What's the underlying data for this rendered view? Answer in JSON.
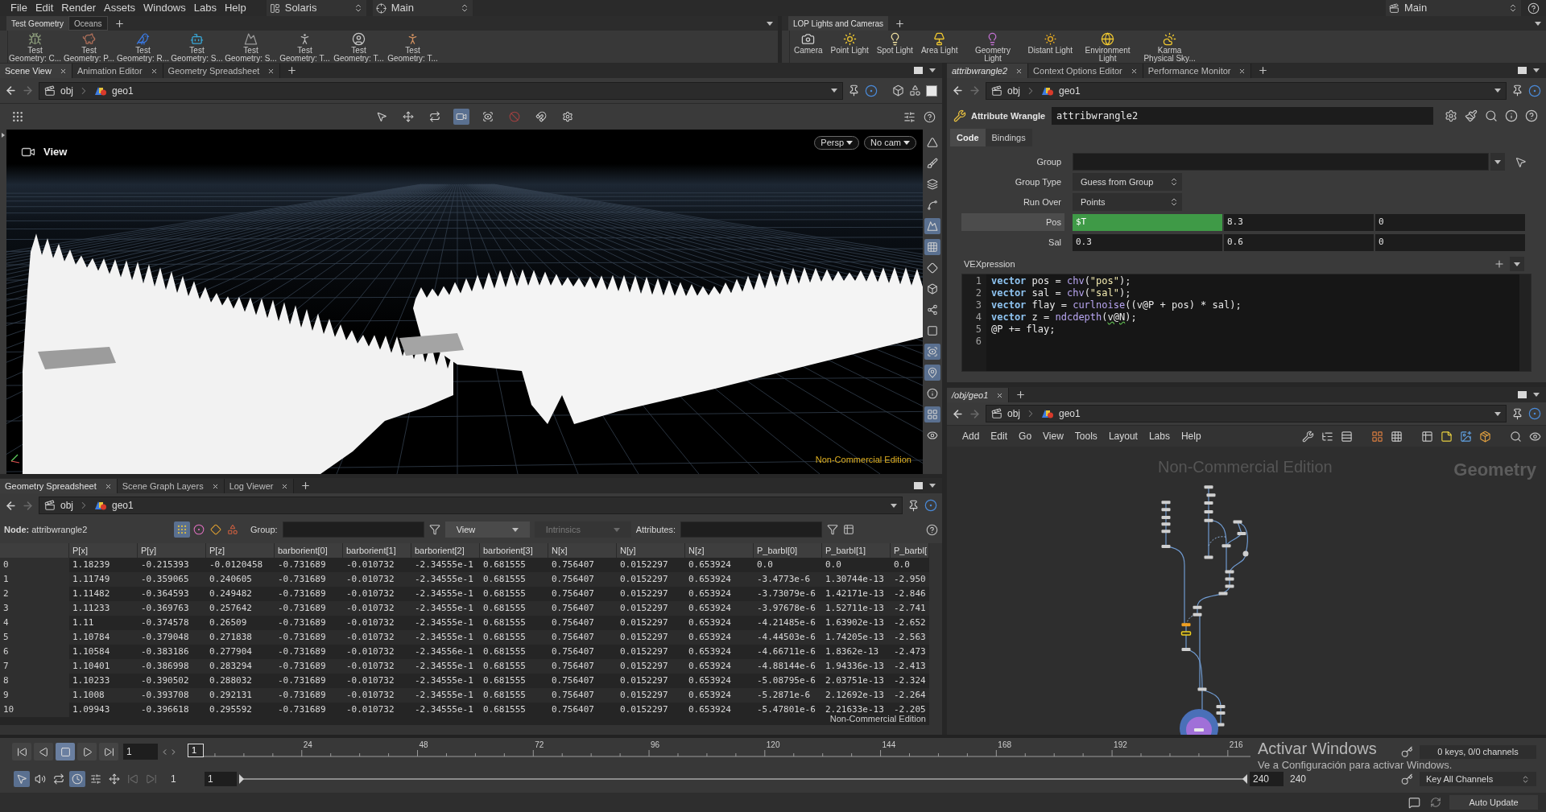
{
  "menu_bar": {
    "items": [
      "File",
      "Edit",
      "Render",
      "Assets",
      "Windows",
      "Labs",
      "Help"
    ],
    "desktop": "Solaris",
    "context": "Main",
    "right_desktop": "Main"
  },
  "shelves": [
    {
      "tabs": [
        {
          "label": "Test Geometry",
          "selected": true
        },
        {
          "label": "Oceans",
          "selected": false
        }
      ],
      "tools": [
        "Test Geometry: C...",
        "Test Geometry: P...",
        "Test Geometry: R...",
        "Test Geometry: S...",
        "Test Geometry: S...",
        "Test Geometry: T...",
        "Test Geometry: T...",
        "Test Geometry: T..."
      ]
    },
    {
      "tabs": [
        {
          "label": "LOP Lights and Cameras",
          "selected": true
        }
      ],
      "tools": [
        "Camera",
        "Point Light",
        "Spot Light",
        "Area Light",
        "Geometry Light",
        "Distant Light",
        "Environment Light",
        "Karma Physical Sky..."
      ]
    }
  ],
  "scene_view": {
    "tabs": [
      {
        "label": "Scene View",
        "selected": true
      },
      {
        "label": "Animation Editor",
        "selected": false
      },
      {
        "label": "Geometry Spreadsheet",
        "selected": false
      }
    ],
    "path": [
      "obj",
      "geo1"
    ],
    "viewport": {
      "title": "View",
      "camera_menus": [
        "Persp",
        "No cam"
      ],
      "watermark": "Non-Commercial Edition"
    }
  },
  "spreadsheet": {
    "tabs": [
      {
        "label": "Geometry Spreadsheet",
        "selected": true
      },
      {
        "label": "Scene Graph Layers",
        "selected": false
      },
      {
        "label": "Log Viewer",
        "selected": false
      }
    ],
    "path": [
      "obj",
      "geo1"
    ],
    "node_label": "**Node:** attribwrangle2",
    "element_types": [
      {
        "selected": true
      },
      {
        "selected": false
      },
      {
        "selected": false
      },
      {
        "selected": false
      }
    ],
    "group_label": "Group:",
    "view_menu": "View",
    "intrinsics_menu": {
      "label": "Intrinsics",
      "disabled": true
    },
    "attributes_label": "Attributes:",
    "columns": [
      "P[x]",
      "P[y]",
      "P[z]",
      "barborient[0]",
      "barborient[1]",
      "barborient[2]",
      "barborient[3]",
      "N[x]",
      "N[y]",
      "N[z]",
      "P_barbl[0]",
      "P_barbl[1]",
      "P_barbl["
    ],
    "rows": [
      {
        "index": "0",
        "cells": [
          "1.18239",
          "-0.215393",
          "-0.0120458",
          "-0.731689",
          "-0.010732",
          "-2.34555e-1",
          "0.681555",
          "0.756407",
          "0.0152297",
          "0.653924",
          "0.0",
          "0.0",
          "0.0"
        ]
      },
      {
        "index": "1",
        "cells": [
          "1.11749",
          "-0.359065",
          "0.240605",
          "-0.731689",
          "-0.010732",
          "-2.34555e-1",
          "0.681555",
          "0.756407",
          "0.0152297",
          "0.653924",
          "-3.4773e-6",
          "1.30744e-13",
          "-2.950"
        ]
      },
      {
        "index": "2",
        "cells": [
          "1.11482",
          "-0.364593",
          "0.249482",
          "-0.731689",
          "-0.010732",
          "-2.34555e-1",
          "0.681555",
          "0.756407",
          "0.0152297",
          "0.653924",
          "-3.73079e-6",
          "1.42171e-13",
          "-2.846"
        ]
      },
      {
        "index": "3",
        "cells": [
          "1.11233",
          "-0.369763",
          "0.257642",
          "-0.731689",
          "-0.010732",
          "-2.34555e-1",
          "0.681555",
          "0.756407",
          "0.0152297",
          "0.653924",
          "-3.97678e-6",
          "1.52711e-13",
          "-2.741"
        ]
      },
      {
        "index": "4",
        "cells": [
          "1.11",
          "-0.374578",
          "0.26509",
          "-0.731689",
          "-0.010732",
          "-2.34555e-1",
          "0.681555",
          "0.756407",
          "0.0152297",
          "0.653924",
          "-4.21485e-6",
          "1.63902e-13",
          "-2.652"
        ]
      },
      {
        "index": "5",
        "cells": [
          "1.10784",
          "-0.379048",
          "0.271838",
          "-0.731689",
          "-0.010732",
          "-2.34555e-1",
          "0.681555",
          "0.756407",
          "0.0152297",
          "0.653924",
          "-4.44503e-6",
          "1.74205e-13",
          "-2.563"
        ]
      },
      {
        "index": "6",
        "cells": [
          "1.10584",
          "-0.383186",
          "0.277904",
          "-0.731689",
          "-0.010732",
          "-2.34556e-1",
          "0.681555",
          "0.756407",
          "0.0152297",
          "0.653924",
          "-4.66711e-6",
          "1.8362e-13",
          "-2.473"
        ]
      },
      {
        "index": "7",
        "cells": [
          "1.10401",
          "-0.386998",
          "0.283294",
          "-0.731689",
          "-0.010732",
          "-2.34555e-1",
          "0.681555",
          "0.756407",
          "0.0152297",
          "0.653924",
          "-4.88144e-6",
          "1.94336e-13",
          "-2.413"
        ]
      },
      {
        "index": "8",
        "cells": [
          "1.10233",
          "-0.390502",
          "0.288032",
          "-0.731689",
          "-0.010732",
          "-2.34555e-1",
          "0.681555",
          "0.756407",
          "0.0152297",
          "0.653924",
          "-5.08795e-6",
          "2.03751e-13",
          "-2.324"
        ]
      },
      {
        "index": "9",
        "cells": [
          "1.1008",
          "-0.393708",
          "0.292131",
          "-0.731689",
          "-0.010732",
          "-2.34555e-1",
          "0.681555",
          "0.756407",
          "0.0152297",
          "0.653924",
          "-5.2871e-6",
          "2.12692e-13",
          "-2.264"
        ]
      },
      {
        "index": "10",
        "cells": [
          "1.09943",
          "-0.396618",
          "0.295592",
          "-0.731689",
          "-0.010732",
          "-2.34555e-1",
          "0.681555",
          "0.756407",
          "0.0152297",
          "0.653924",
          "-5.47801e-6",
          "2.21633e-13",
          "-2.205"
        ]
      }
    ],
    "watermark": "Non-Commercial Edition"
  },
  "parameters": {
    "tabs": [
      {
        "label": "attribwrangle2",
        "selected": true
      },
      {
        "label": "Context Options Editor",
        "selected": false
      },
      {
        "label": "Performance Monitor",
        "selected": false
      }
    ],
    "path": [
      "obj",
      "geo1"
    ],
    "node_type": "Attribute Wrangle",
    "node_name": "attribwrangle2",
    "sections": [
      {
        "label": "Code",
        "selected": true
      },
      {
        "label": "Bindings",
        "selected": false
      }
    ],
    "fields": [
      {
        "kind": "text",
        "label": "Group"
      },
      {
        "kind": "menu",
        "label": "Group Type",
        "value": "Guess from Group"
      },
      {
        "kind": "menu",
        "label": "Run Over",
        "value": "Points"
      },
      {
        "kind": "vector",
        "label": "Pos",
        "highlighted": true,
        "values": [
          {
            "text": "$T",
            "animated": true
          },
          {
            "text": "8.3",
            "animated": false
          },
          {
            "text": "0",
            "animated": false
          }
        ]
      },
      {
        "kind": "vector",
        "label": "Sal",
        "highlighted": false,
        "values": [
          {
            "text": "0.3",
            "animated": false
          },
          {
            "text": "0.6",
            "animated": false
          },
          {
            "text": "0",
            "animated": false
          }
        ]
      }
    ],
    "code_label": "VEXpression",
    "code": [
      {
        "number": "1",
        "tokens": [
          {
            "kind": "type",
            "text": "vector"
          },
          {
            "kind": "plain",
            "text": " pos = "
          },
          {
            "kind": "func",
            "text": "chv"
          },
          {
            "kind": "plain",
            "text": "("
          },
          {
            "kind": "string",
            "text": "\"pos\""
          },
          {
            "kind": "plain",
            "text": ");"
          }
        ]
      },
      {
        "number": "2",
        "tokens": [
          {
            "kind": "type",
            "text": "vector"
          },
          {
            "kind": "plain",
            "text": " sal = "
          },
          {
            "kind": "func",
            "text": "chv"
          },
          {
            "kind": "plain",
            "text": "("
          },
          {
            "kind": "string",
            "text": "\"sal\""
          },
          {
            "kind": "plain",
            "text": ");"
          }
        ]
      },
      {
        "number": "3",
        "tokens": [
          {
            "kind": "type",
            "text": "vector"
          },
          {
            "kind": "plain",
            "text": " flay = "
          },
          {
            "kind": "func",
            "text": "curlnoise"
          },
          {
            "kind": "plain",
            "text": "((v@P + pos) * sal);"
          }
        ]
      },
      {
        "number": "4",
        "tokens": [
          {
            "kind": "type",
            "text": "vector"
          },
          {
            "kind": "plain",
            "text": " z = "
          },
          {
            "kind": "func",
            "text": "ndcdepth"
          },
          {
            "kind": "plain",
            "text": "("
          },
          {
            "kind": "warn",
            "text": "v@N"
          },
          {
            "kind": "plain",
            "text": ");"
          }
        ]
      },
      {
        "number": "5",
        "tokens": [
          {
            "kind": "plain",
            "text": "@P += flay;"
          }
        ]
      },
      {
        "number": "6"
      }
    ]
  },
  "network": {
    "tabs": [
      {
        "label": "/obj/geo1",
        "selected": true
      }
    ],
    "path": [
      "obj",
      "geo1"
    ],
    "menu": [
      "Add",
      "Edit",
      "Go",
      "View",
      "Tools",
      "Layout",
      "Labs",
      "Help"
    ],
    "watermark": "Non-Commercial Edition",
    "context": "Geometry"
  },
  "timeline": {
    "playing": false,
    "frame": "1",
    "marker": "1",
    "ticks": [
      "24",
      "48",
      "72",
      "96",
      "120",
      "144",
      "168",
      "192",
      "216"
    ],
    "range_start": [
      "1",
      "1"
    ],
    "range_bar": {
      "level": 1
    },
    "range_end": [
      "240",
      "240"
    ],
    "keys": "0 keys, 0/0 channels",
    "key_mode": "Key All Channels",
    "update_mode": "Auto Update"
  },
  "os_notice": {
    "title": "Activar Windows",
    "text": "Ve a Configuración para activar Windows."
  }
}
